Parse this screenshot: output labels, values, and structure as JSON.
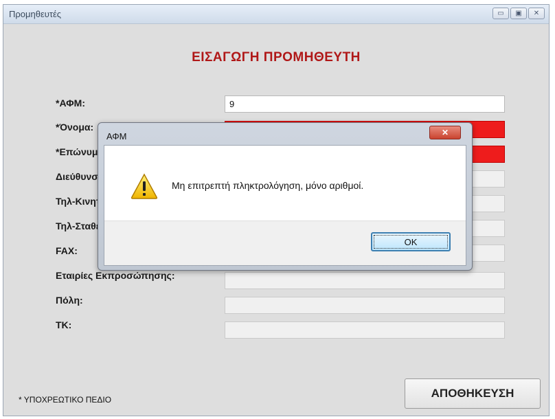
{
  "window": {
    "title": "Προμηθευτές"
  },
  "form": {
    "heading": "ΕΙΣΑΓΩΓΗ ΠΡΟΜΗΘΕΥΤΗ",
    "fields": [
      {
        "label": "*ΑΦΜ:",
        "value": "9"
      },
      {
        "label": "*Όνομα:",
        "value": ""
      },
      {
        "label": "*Επώνυμο:",
        "value": ""
      },
      {
        "label": "Διεύθυνση:",
        "value": ""
      },
      {
        "label": "Τηλ-Κινητό:",
        "value": ""
      },
      {
        "label": "Τηλ-Σταθερό:",
        "value": ""
      },
      {
        "label": "FAX:",
        "value": ""
      },
      {
        "label": "Εταιρίες Εκπροσώπησης:",
        "value": ""
      },
      {
        "label": "Πόλη:",
        "value": ""
      },
      {
        "label": "ΤΚ:",
        "value": ""
      }
    ],
    "required_note": "* ΥΠΟΧΡΕΩΤΙΚΟ ΠΕΔΙΟ",
    "save_label": "ΑΠΟΘΗΚΕΥΣΗ"
  },
  "dialog": {
    "title": "ΑΦΜ",
    "message": "Μη επιτρεπτή πληκτρολόγηση, μόνο αριθμοί.",
    "ok_label": "OK",
    "icon": "warning-icon"
  },
  "colors": {
    "heading": "#b01818",
    "error_field": "#ee1c1c"
  }
}
